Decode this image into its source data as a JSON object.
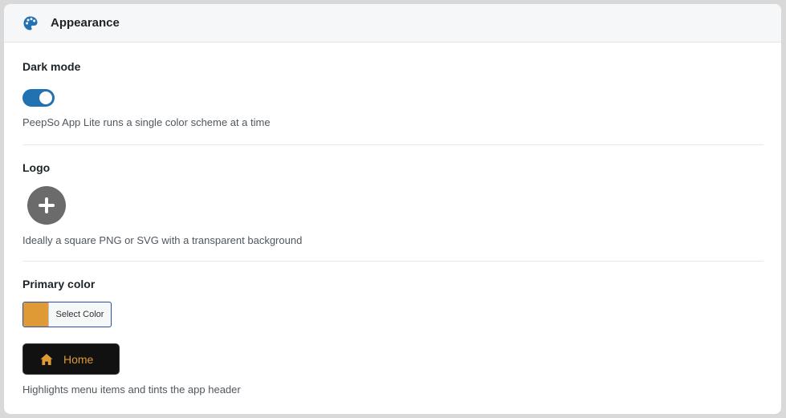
{
  "header": {
    "title": "Appearance",
    "icon": "palette-icon",
    "icon_color": "#2271b1"
  },
  "dark_mode": {
    "title": "Dark mode",
    "enabled": true,
    "toggle_color": "#2271b1",
    "help": "PeepSo App Lite runs a single color scheme at a time"
  },
  "logo": {
    "title": "Logo",
    "add_icon": "plus-icon",
    "help": "Ideally a square PNG or SVG with a transparent background"
  },
  "primary_color": {
    "title": "Primary color",
    "swatch_color": "#e09a35",
    "select_label": "Select Color",
    "preview": {
      "icon": "home-icon",
      "label": "Home"
    },
    "help": "Highlights menu items and tints the app header"
  }
}
